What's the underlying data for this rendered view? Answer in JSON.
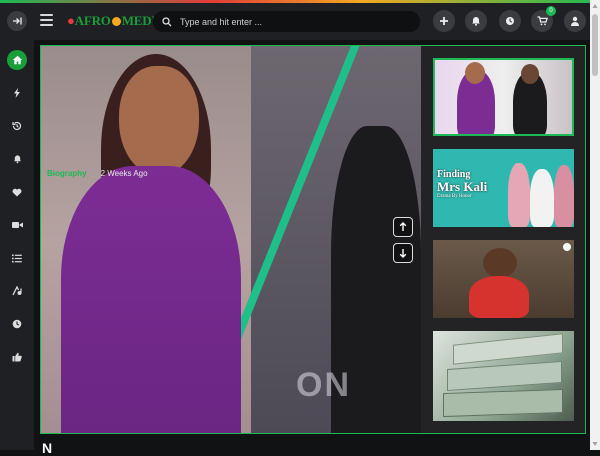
{
  "brand": {
    "logo_prefix": "AFRO",
    "logo_suffix": "MEDY"
  },
  "search": {
    "placeholder": "Type and hit enter ..."
  },
  "cart": {
    "count": "0"
  },
  "hero": {
    "category": "Biography",
    "time": "2 Weeks Ago",
    "poster_text": "ON"
  },
  "thumbnails": [
    {
      "title_line1": "Finding",
      "title_line2": "Mrs Kali",
      "subtitle": "Drama By Honor"
    }
  ],
  "footer": {
    "visible_letter": "N"
  },
  "colors": {
    "accent": "#1db954",
    "header_bg": "#1e2023",
    "page_bg": "#111214"
  },
  "icons": {
    "sidebar": [
      "collapse-icon",
      "home-icon",
      "flash-icon",
      "history-icon",
      "bell-icon",
      "heart-icon",
      "video-icon",
      "list-icon",
      "playlist-icon",
      "clock-icon",
      "thumbs-up-icon"
    ],
    "header": [
      "add-icon",
      "notification-icon",
      "clock-icon",
      "cart-icon",
      "user-icon"
    ]
  }
}
